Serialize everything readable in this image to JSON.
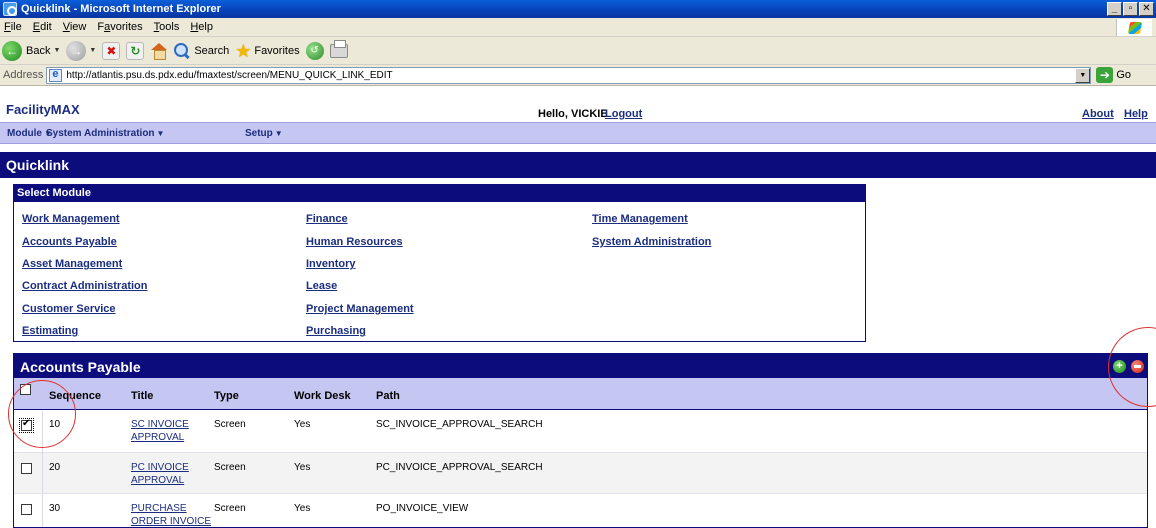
{
  "window": {
    "title": "Quicklink - Microsoft Internet Explorer",
    "buttons": [
      "_",
      "▫",
      "✕"
    ]
  },
  "menu": {
    "items": [
      {
        "ul": "F",
        "rest": "ile"
      },
      {
        "ul": "E",
        "rest": "dit"
      },
      {
        "ul": "V",
        "rest": "iew"
      },
      {
        "pre": "F",
        "ul": "a",
        "rest": "vorites"
      },
      {
        "ul": "T",
        "rest": "ools"
      },
      {
        "ul": "H",
        "rest": "elp"
      }
    ]
  },
  "toolbar": {
    "back": "Back",
    "search": "Search",
    "favorites": "Favorites"
  },
  "address": {
    "label": "Address",
    "url": "http://atlantis.psu.ds.pdx.edu/fmaxtest/screen/MENU_QUICK_LINK_EDIT",
    "go": "Go"
  },
  "app": {
    "brand": "FacilityMAX",
    "greeting": "Hello, VICKIE",
    "logout": "Logout",
    "about": "About",
    "help": "Help",
    "nav": [
      "Module",
      "System Administration",
      "Setup"
    ],
    "page_title": "Quicklink"
  },
  "select_module": {
    "heading": "Select Module",
    "col1": [
      "Work Management",
      "Accounts Payable",
      "Asset Management",
      "Contract Administration",
      "Customer Service",
      "Estimating"
    ],
    "col2": [
      "Finance",
      "Human Resources",
      "Inventory",
      "Lease",
      "Project Management",
      "Purchasing"
    ],
    "col3": [
      "Time Management",
      "System Administration"
    ]
  },
  "accounts_payable": {
    "heading": "Accounts Payable",
    "columns": [
      "Sequence",
      "Title",
      "Type",
      "Work Desk",
      "Path"
    ],
    "rows": [
      {
        "checked": true,
        "sequence": "10",
        "title1": "SC INVOICE",
        "title2": "APPROVAL",
        "type": "Screen",
        "work_desk": "Yes",
        "path": "SC_INVOICE_APPROVAL_SEARCH"
      },
      {
        "checked": false,
        "sequence": "20",
        "title1": "PC INVOICE",
        "title2": "APPROVAL",
        "type": "Screen",
        "work_desk": "Yes",
        "path": "PC_INVOICE_APPROVAL_SEARCH"
      },
      {
        "checked": false,
        "sequence": "30",
        "title1": "PURCHASE",
        "title2": "ORDER INVOICE",
        "type": "Screen",
        "work_desk": "Yes",
        "path": "PO_INVOICE_VIEW"
      }
    ]
  },
  "colors": {
    "navy": "#0c0c7c",
    "lavender": "#c6c6f2",
    "link": "#1b2d7f",
    "annotation": "#e03030"
  }
}
